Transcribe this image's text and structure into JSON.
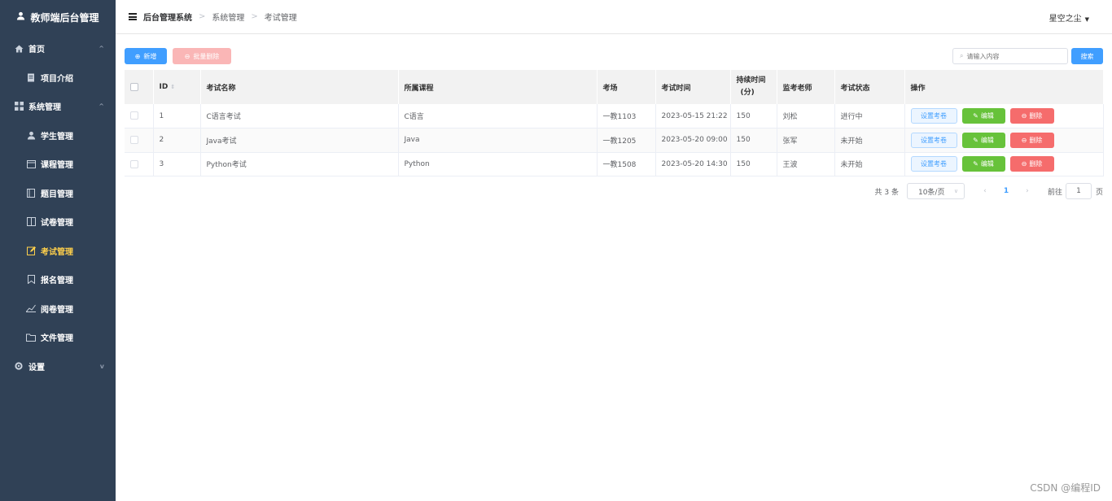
{
  "sidebar": {
    "brand": "教师端后台管理",
    "items": [
      {
        "label": "首页",
        "icon": "home-icon",
        "level": "top",
        "arrow": "^"
      },
      {
        "label": "项目介绍",
        "icon": "document-icon",
        "level": "sub"
      },
      {
        "label": "系统管理",
        "icon": "grid-icon",
        "level": "top",
        "arrow": "^"
      },
      {
        "label": "学生管理",
        "icon": "user-icon",
        "level": "sub"
      },
      {
        "label": "课程管理",
        "icon": "calendar-icon",
        "level": "sub"
      },
      {
        "label": "题目管理",
        "icon": "book-icon",
        "level": "sub"
      },
      {
        "label": "试卷管理",
        "icon": "paper-icon",
        "level": "sub"
      },
      {
        "label": "考试管理",
        "icon": "edit-icon",
        "level": "sub",
        "active": true
      },
      {
        "label": "报名管理",
        "icon": "bookmark-icon",
        "level": "sub"
      },
      {
        "label": "阅卷管理",
        "icon": "chart-icon",
        "level": "sub"
      },
      {
        "label": "文件管理",
        "icon": "folder-icon",
        "level": "sub"
      },
      {
        "label": "设置",
        "icon": "gear-icon",
        "level": "top",
        "arrow": "v"
      }
    ]
  },
  "header": {
    "breadcrumb": [
      "后台管理系统",
      "系统管理",
      "考试管理"
    ],
    "user": "星空之尘"
  },
  "toolbar": {
    "add_label": "新增",
    "batch_delete_label": "批量删除",
    "search_placeholder": "请输入内容",
    "search_label": "搜索"
  },
  "table": {
    "columns": [
      "ID",
      "考试名称",
      "所属课程",
      "考场",
      "考试时间",
      "持续时间(分)",
      "监考老师",
      "考试状态",
      "操作"
    ],
    "duration_header": {
      "line1": "持续时间",
      "line2": "(分)"
    },
    "rows": [
      {
        "id": "1",
        "name": "C语言考试",
        "course": "C语言",
        "room": "一教1103",
        "time": "2023-05-15 21:22",
        "duration": "150",
        "teacher": "刘松",
        "status": "进行中"
      },
      {
        "id": "2",
        "name": "Java考试",
        "course": "Java",
        "room": "一教1205",
        "time": "2023-05-20 09:00",
        "duration": "150",
        "teacher": "张军",
        "status": "未开始"
      },
      {
        "id": "3",
        "name": "Python考试",
        "course": "Python",
        "room": "一教1508",
        "time": "2023-05-20 14:30",
        "duration": "150",
        "teacher": "王波",
        "status": "未开始"
      }
    ],
    "actions": {
      "set_paper": "设置考卷",
      "edit": "编辑",
      "delete": "删除"
    }
  },
  "pagination": {
    "total": "共 3 条",
    "page_size": "10条/页",
    "current_page": "1",
    "goto_label": "前往",
    "goto_value": "1",
    "page_suffix": "页"
  },
  "watermark": "CSDN @编程ID",
  "colors": {
    "sidebar_bg": "#304156",
    "primary": "#409eff",
    "active_menu": "#ffd04b",
    "success": "#67c23a",
    "danger": "#f56c6c"
  }
}
